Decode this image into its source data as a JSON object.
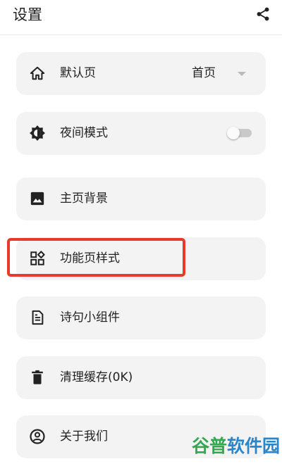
{
  "header": {
    "title": "设置",
    "share_icon": "share-icon"
  },
  "settings": {
    "items": [
      {
        "label": "默认页",
        "icon": "home-icon",
        "value": "首页"
      },
      {
        "label": "夜间模式",
        "icon": "brightness-icon",
        "toggle_on": false
      },
      {
        "label": "主页背景",
        "icon": "image-icon"
      },
      {
        "label": "功能页样式",
        "icon": "widgets-icon"
      },
      {
        "label": "诗句小组件",
        "icon": "document-icon"
      },
      {
        "label": "清理缓存(0K)",
        "icon": "trash-icon"
      },
      {
        "label": "关于我们",
        "icon": "account-circle-icon"
      }
    ]
  },
  "colors": {
    "highlight": "#e8392c",
    "card_bg": "#f3f3f3"
  },
  "watermark": {
    "part1": "谷普",
    "part2": "软件园"
  }
}
